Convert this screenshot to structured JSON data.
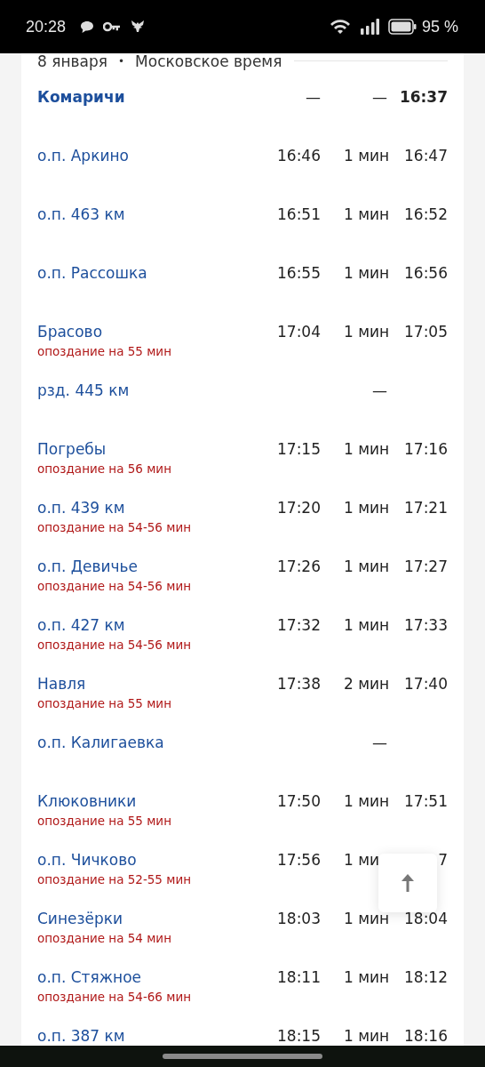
{
  "status_bar": {
    "time": "20:28",
    "battery": "95 %"
  },
  "header": {
    "date": "8 января",
    "separator": "•",
    "timezone": "Московское время"
  },
  "stops": [
    {
      "kind": "origin",
      "name": "Комаричи",
      "arrival": "—",
      "stop": "—",
      "departure": "16:37"
    },
    {
      "kind": "stop",
      "name": "о.п. Аркино",
      "arrival": "16:46",
      "stop": "1 мин",
      "departure": "16:47"
    },
    {
      "kind": "stop",
      "name": "о.п. 463 км",
      "arrival": "16:51",
      "stop": "1 мин",
      "departure": "16:52"
    },
    {
      "kind": "stop",
      "name": "о.п. Рассошка",
      "arrival": "16:55",
      "stop": "1 мин",
      "departure": "16:56"
    },
    {
      "kind": "stop",
      "name": "Брасово",
      "arrival": "17:04",
      "stop": "1 мин",
      "departure": "17:05",
      "delay": "опоздание на 55 мин"
    },
    {
      "kind": "stop",
      "name": "рзд. 445 км",
      "stop": "—"
    },
    {
      "kind": "stop",
      "name": "Погребы",
      "arrival": "17:15",
      "stop": "1 мин",
      "departure": "17:16",
      "delay": "опоздание на 56 мин"
    },
    {
      "kind": "stop",
      "name": "о.п. 439 км",
      "arrival": "17:20",
      "stop": "1 мин",
      "departure": "17:21",
      "delay": "опоздание на 54-56 мин"
    },
    {
      "kind": "stop",
      "name": "о.п. Девичье",
      "arrival": "17:26",
      "stop": "1 мин",
      "departure": "17:27",
      "delay": "опоздание на 54-56 мин"
    },
    {
      "kind": "stop",
      "name": "о.п. 427 км",
      "arrival": "17:32",
      "stop": "1 мин",
      "departure": "17:33",
      "delay": "опоздание на 54-56 мин"
    },
    {
      "kind": "stop",
      "name": "Навля",
      "arrival": "17:38",
      "stop": "2 мин",
      "departure": "17:40",
      "delay": "опоздание на 55 мин"
    },
    {
      "kind": "stop",
      "name": "о.п. Калигаевка",
      "stop": "—"
    },
    {
      "kind": "stop",
      "name": "Клюковники",
      "arrival": "17:50",
      "stop": "1 мин",
      "departure": "17:51",
      "delay": "опоздание на 55 мин"
    },
    {
      "kind": "stop",
      "name": "о.п. Чичково",
      "arrival": "17:56",
      "stop": "1 ми",
      "departure": "7",
      "delay": "опоздание на 52-55 мин"
    },
    {
      "kind": "stop",
      "name": "Синезёрки",
      "arrival": "18:03",
      "stop": "1 мин",
      "departure": "18:04",
      "delay": "опоздание на 54 мин"
    },
    {
      "kind": "stop",
      "name": "о.п. Стяжное",
      "arrival": "18:11",
      "stop": "1 мин",
      "departure": "18:12",
      "delay": "опоздание на 54-66 мин"
    },
    {
      "kind": "stop",
      "name": "о.п. 387 км",
      "arrival": "18:15",
      "stop": "1 мин",
      "departure": "18:16"
    }
  ]
}
